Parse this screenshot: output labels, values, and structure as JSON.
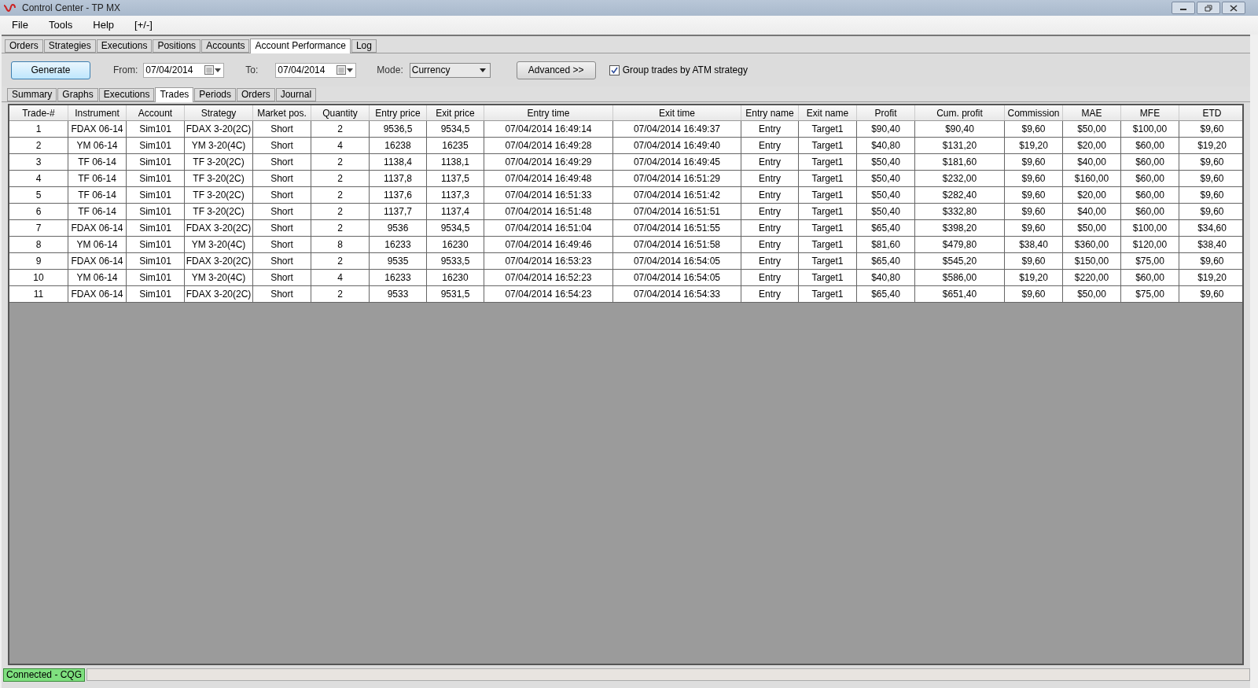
{
  "window": {
    "title": "Control Center - TP MX"
  },
  "menu": [
    "File",
    "Tools",
    "Help",
    "[+/-]"
  ],
  "main_tabs": [
    {
      "label": "Orders",
      "selected": false
    },
    {
      "label": "Strategies",
      "selected": false
    },
    {
      "label": "Executions",
      "selected": false
    },
    {
      "label": "Positions",
      "selected": false
    },
    {
      "label": "Accounts",
      "selected": false
    },
    {
      "label": "Account Performance",
      "selected": true
    },
    {
      "label": "Log",
      "selected": false
    }
  ],
  "toolbar": {
    "generate": "Generate",
    "from_label": "From:",
    "from_value": "07/04/2014",
    "to_label": "To:",
    "to_value": "07/04/2014",
    "mode_label": "Mode:",
    "mode_value": "Currency",
    "advanced": "Advanced >>",
    "group_checkbox": {
      "label": "Group trades by ATM strategy",
      "checked": true
    }
  },
  "sub_tabs": [
    {
      "label": "Summary",
      "selected": false
    },
    {
      "label": "Graphs",
      "selected": false
    },
    {
      "label": "Executions",
      "selected": false
    },
    {
      "label": "Trades",
      "selected": true
    },
    {
      "label": "Periods",
      "selected": false
    },
    {
      "label": "Orders",
      "selected": false
    },
    {
      "label": "Journal",
      "selected": false
    }
  ],
  "table": {
    "columns": [
      "Trade-#",
      "Instrument",
      "Account",
      "Strategy",
      "Market pos.",
      "Quantity",
      "Entry price",
      "Exit price",
      "Entry time",
      "Exit time",
      "Entry name",
      "Exit name",
      "Profit",
      "Cum. profit",
      "Commission",
      "MAE",
      "MFE",
      "ETD"
    ],
    "rows": [
      [
        "1",
        "FDAX 06-14",
        "Sim101",
        "FDAX 3-20(2C)",
        "Short",
        "2",
        "9536,5",
        "9534,5",
        "07/04/2014 16:49:14",
        "07/04/2014 16:49:37",
        "Entry",
        "Target1",
        "$90,40",
        "$90,40",
        "$9,60",
        "$50,00",
        "$100,00",
        "$9,60"
      ],
      [
        "2",
        "YM 06-14",
        "Sim101",
        "YM 3-20(4C)",
        "Short",
        "4",
        "16238",
        "16235",
        "07/04/2014 16:49:28",
        "07/04/2014 16:49:40",
        "Entry",
        "Target1",
        "$40,80",
        "$131,20",
        "$19,20",
        "$20,00",
        "$60,00",
        "$19,20"
      ],
      [
        "3",
        "TF 06-14",
        "Sim101",
        "TF 3-20(2C)",
        "Short",
        "2",
        "1138,4",
        "1138,1",
        "07/04/2014 16:49:29",
        "07/04/2014 16:49:45",
        "Entry",
        "Target1",
        "$50,40",
        "$181,60",
        "$9,60",
        "$40,00",
        "$60,00",
        "$9,60"
      ],
      [
        "4",
        "TF 06-14",
        "Sim101",
        "TF 3-20(2C)",
        "Short",
        "2",
        "1137,8",
        "1137,5",
        "07/04/2014 16:49:48",
        "07/04/2014 16:51:29",
        "Entry",
        "Target1",
        "$50,40",
        "$232,00",
        "$9,60",
        "$160,00",
        "$60,00",
        "$9,60"
      ],
      [
        "5",
        "TF 06-14",
        "Sim101",
        "TF 3-20(2C)",
        "Short",
        "2",
        "1137,6",
        "1137,3",
        "07/04/2014 16:51:33",
        "07/04/2014 16:51:42",
        "Entry",
        "Target1",
        "$50,40",
        "$282,40",
        "$9,60",
        "$20,00",
        "$60,00",
        "$9,60"
      ],
      [
        "6",
        "TF 06-14",
        "Sim101",
        "TF 3-20(2C)",
        "Short",
        "2",
        "1137,7",
        "1137,4",
        "07/04/2014 16:51:48",
        "07/04/2014 16:51:51",
        "Entry",
        "Target1",
        "$50,40",
        "$332,80",
        "$9,60",
        "$40,00",
        "$60,00",
        "$9,60"
      ],
      [
        "7",
        "FDAX 06-14",
        "Sim101",
        "FDAX 3-20(2C)",
        "Short",
        "2",
        "9536",
        "9534,5",
        "07/04/2014 16:51:04",
        "07/04/2014 16:51:55",
        "Entry",
        "Target1",
        "$65,40",
        "$398,20",
        "$9,60",
        "$50,00",
        "$100,00",
        "$34,60"
      ],
      [
        "8",
        "YM 06-14",
        "Sim101",
        "YM 3-20(4C)",
        "Short",
        "8",
        "16233",
        "16230",
        "07/04/2014 16:49:46",
        "07/04/2014 16:51:58",
        "Entry",
        "Target1",
        "$81,60",
        "$479,80",
        "$38,40",
        "$360,00",
        "$120,00",
        "$38,40"
      ],
      [
        "9",
        "FDAX 06-14",
        "Sim101",
        "FDAX 3-20(2C)",
        "Short",
        "2",
        "9535",
        "9533,5",
        "07/04/2014 16:53:23",
        "07/04/2014 16:54:05",
        "Entry",
        "Target1",
        "$65,40",
        "$545,20",
        "$9,60",
        "$150,00",
        "$75,00",
        "$9,60"
      ],
      [
        "10",
        "YM 06-14",
        "Sim101",
        "YM 3-20(4C)",
        "Short",
        "4",
        "16233",
        "16230",
        "07/04/2014 16:52:23",
        "07/04/2014 16:54:05",
        "Entry",
        "Target1",
        "$40,80",
        "$586,00",
        "$19,20",
        "$220,00",
        "$60,00",
        "$19,20"
      ],
      [
        "11",
        "FDAX 06-14",
        "Sim101",
        "FDAX 3-20(2C)",
        "Short",
        "2",
        "9533",
        "9531,5",
        "07/04/2014 16:54:23",
        "07/04/2014 16:54:33",
        "Entry",
        "Target1",
        "$65,40",
        "$651,40",
        "$9,60",
        "$50,00",
        "$75,00",
        "$9,60"
      ]
    ]
  },
  "status_bar": {
    "connection": "Connected - CQG"
  }
}
